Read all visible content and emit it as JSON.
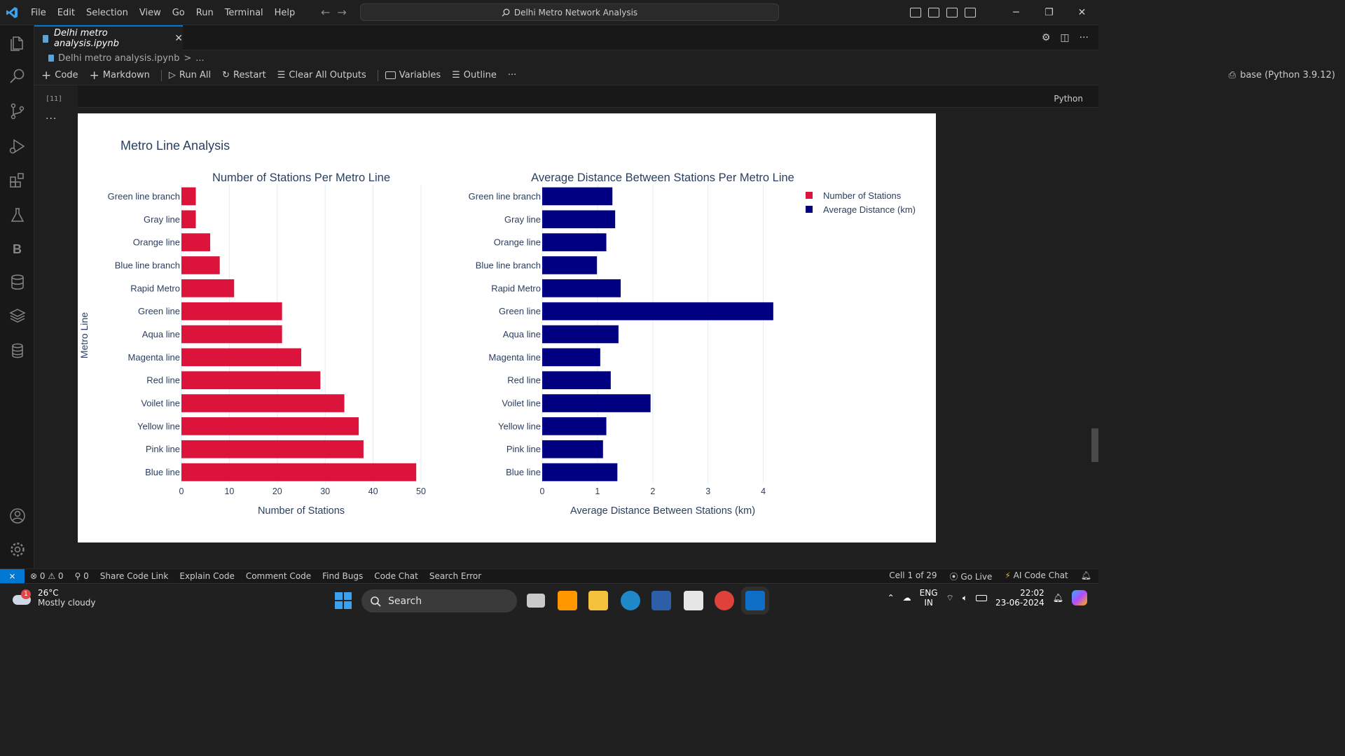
{
  "menu": [
    "File",
    "Edit",
    "Selection",
    "View",
    "Go",
    "Run",
    "Terminal",
    "Help"
  ],
  "search_box": "Delhi Metro Network Analysis",
  "tab": {
    "title": "Delhi metro analysis.ipynb",
    "close": "✕"
  },
  "breadcrumb": {
    "file": "Delhi metro analysis.ipynb",
    "sep": ">",
    "more": "..."
  },
  "toolbar": {
    "code": "Code",
    "markdown": "Markdown",
    "run_all": "Run All",
    "restart": "Restart",
    "clear": "Clear All Outputs",
    "variables": "Variables",
    "outline": "Outline",
    "more": "···"
  },
  "kernel": "base (Python 3.9.12)",
  "cell": {
    "exec_count": "[11]",
    "language": "Python",
    "dots": "···"
  },
  "chart_data": {
    "type": "bar",
    "title": "Metro Line Analysis",
    "ylabel": "Metro Line",
    "categories": [
      "Green line branch",
      "Gray line",
      "Orange line",
      "Blue line branch",
      "Rapid Metro",
      "Green line",
      "Aqua line",
      "Magenta line",
      "Red line",
      "Voilet line",
      "Yellow line",
      "Pink line",
      "Blue line"
    ],
    "legend": [
      "Number of Stations",
      "Average Distance (km)"
    ],
    "legend_position": "top-right",
    "subplots": [
      {
        "title": "Number of Stations Per Metro Line",
        "xlabel": "Number of Stations",
        "xlim": [
          0,
          50
        ],
        "ticks": [
          "0",
          "10",
          "20",
          "30",
          "40",
          "50"
        ],
        "color": "#dc143c",
        "values": [
          3,
          3,
          6,
          8,
          11,
          21,
          21,
          25,
          29,
          34,
          37,
          38,
          49
        ]
      },
      {
        "title": "Average Distance Between Stations Per Metro Line",
        "xlabel": "Average Distance Between Stations (km)",
        "xlim": [
          0,
          4.22
        ],
        "ticks": [
          "0",
          "1",
          "2",
          "3",
          "4"
        ],
        "color": "#000080",
        "values": [
          1.27,
          1.32,
          1.16,
          0.99,
          1.42,
          4.18,
          1.38,
          1.05,
          1.24,
          1.96,
          1.16,
          1.1,
          1.36
        ]
      }
    ]
  },
  "status": {
    "errors": "0",
    "warnings": "0",
    "ports": "0",
    "items": [
      "Share Code Link",
      "Explain Code",
      "Comment Code",
      "Find Bugs",
      "Code Chat",
      "Search Error"
    ],
    "cell": "Cell 1 of 29",
    "golive": "Go Live",
    "ai": "AI Code Chat"
  },
  "taskbar": {
    "temp": "26°C",
    "weather": "Mostly cloudy",
    "search": "Search",
    "lang1": "ENG",
    "lang2": "IN",
    "time": "22:02",
    "date": "23-06-2024",
    "badge": "1"
  }
}
